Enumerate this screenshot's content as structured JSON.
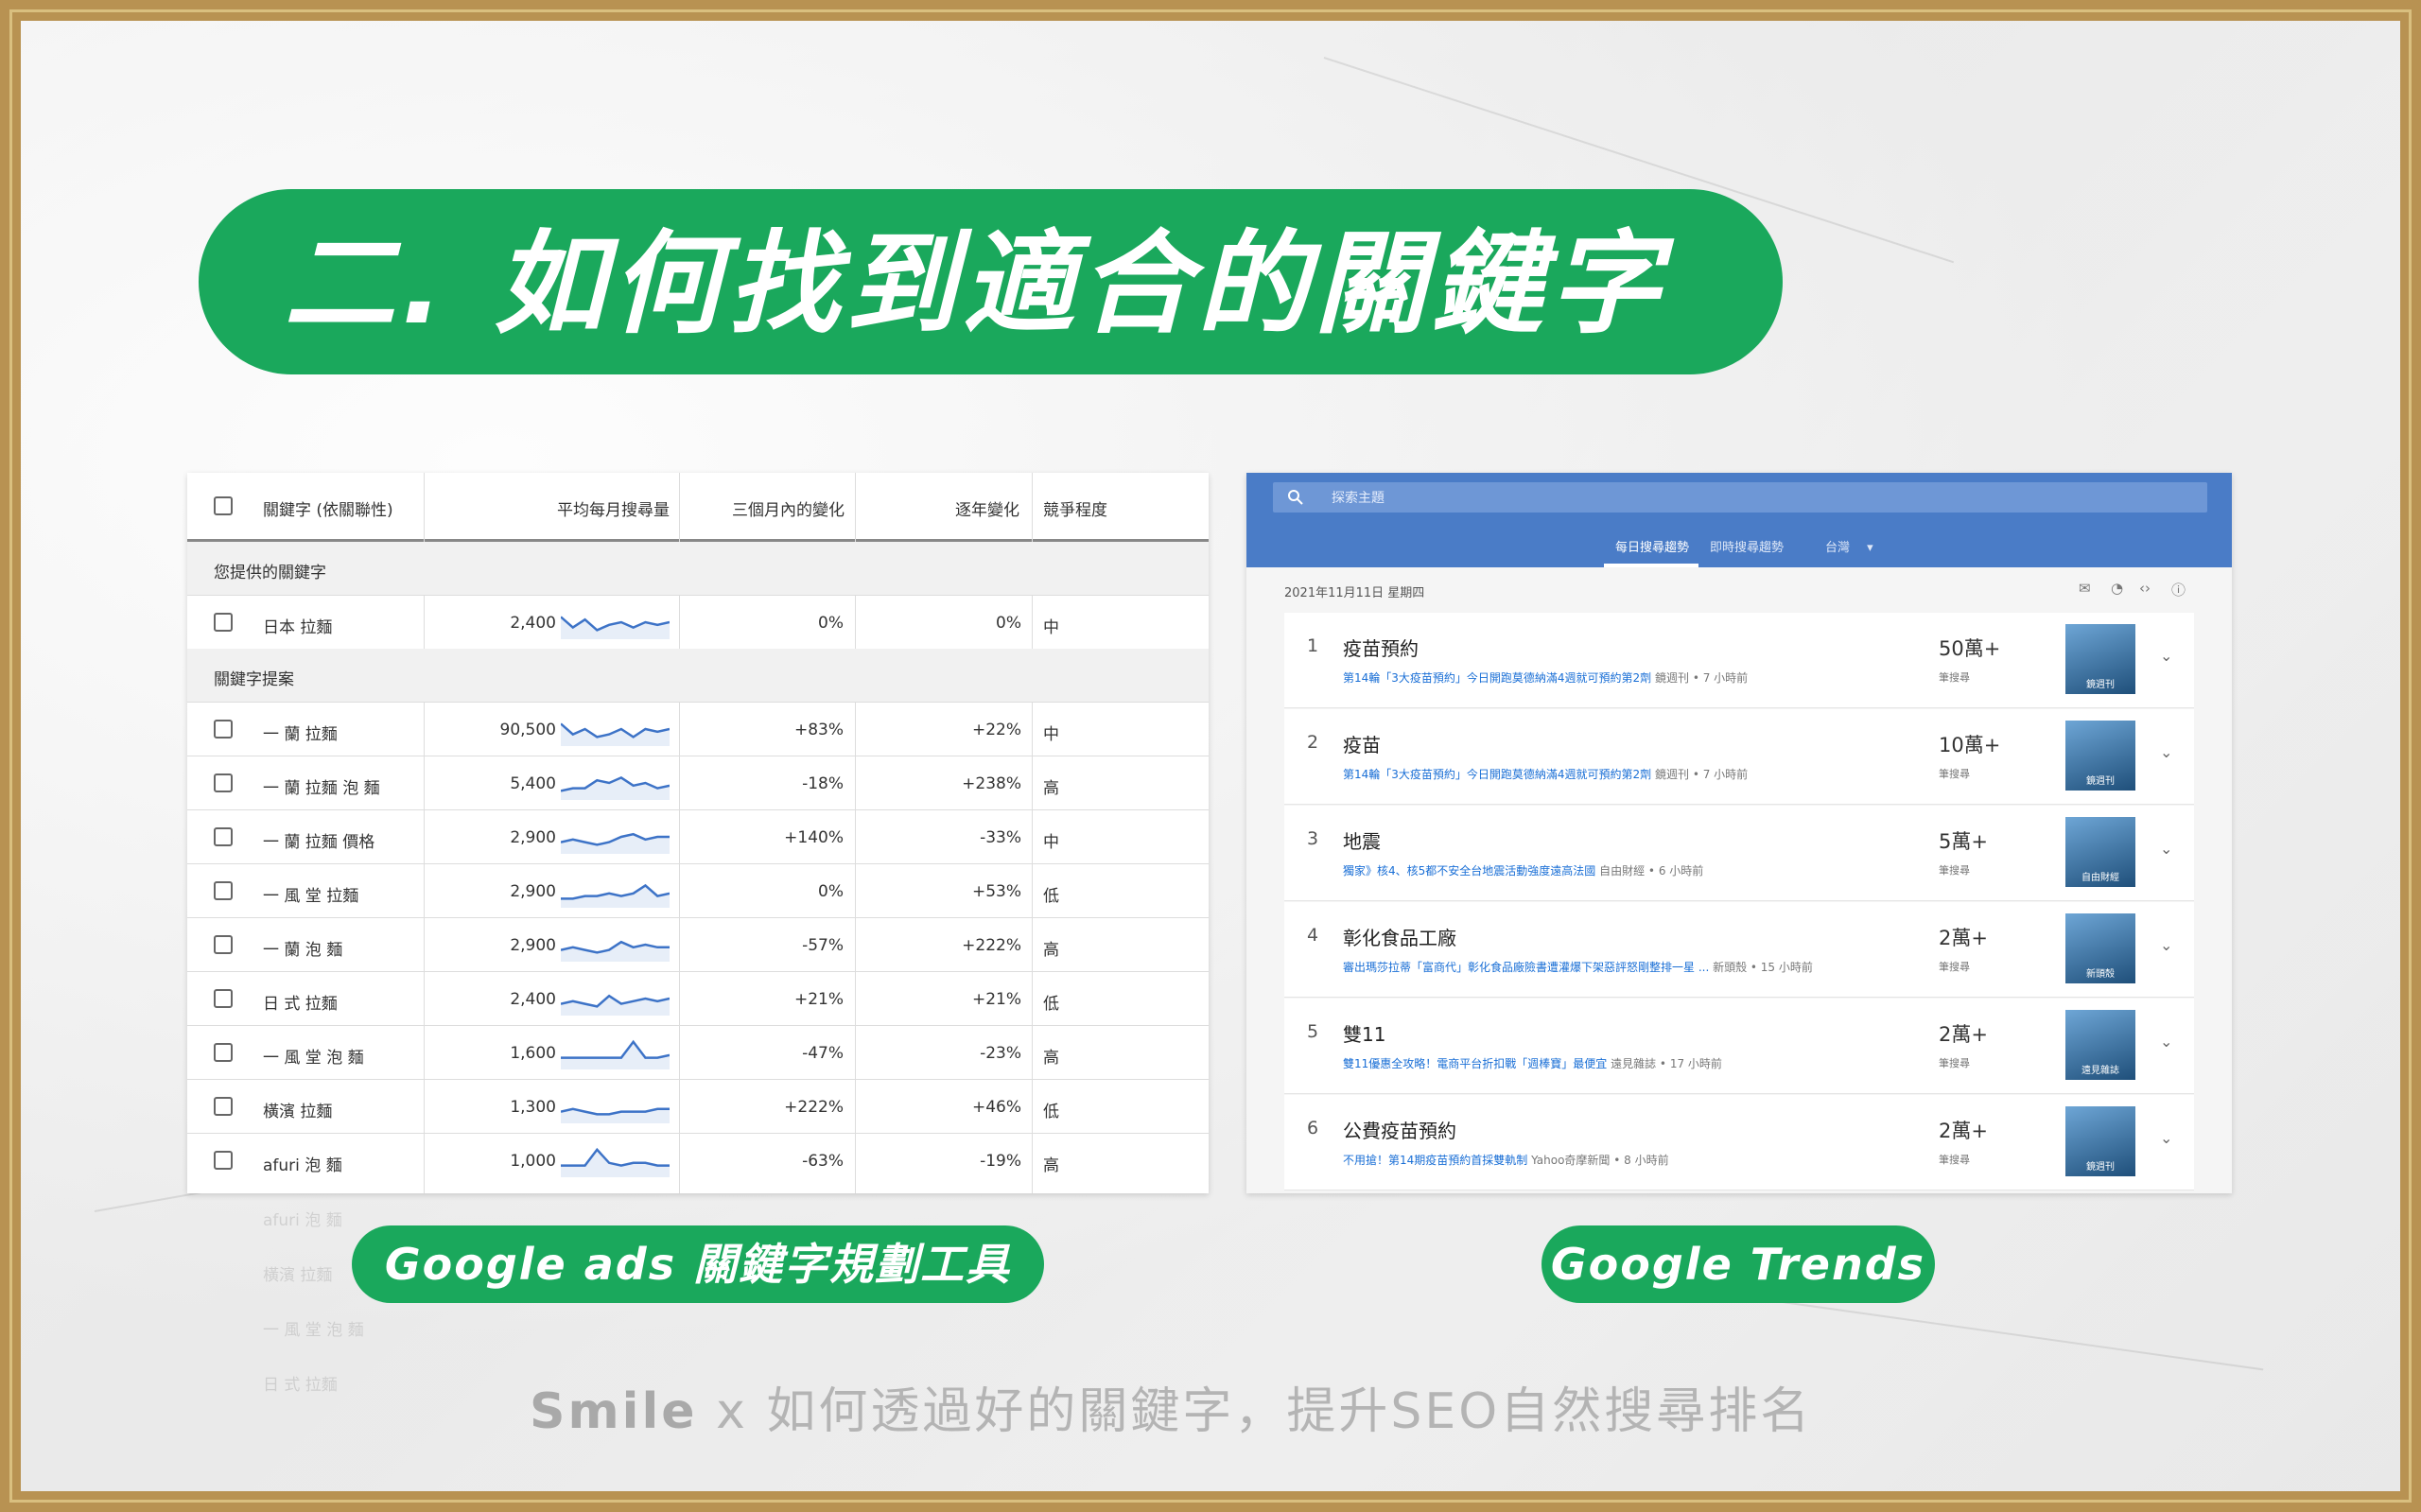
{
  "title": "二. 如何找到適合的關鍵字",
  "ads_table": {
    "headers": [
      "關鍵字 (依關聯性)",
      "平均每月搜尋量",
      "三個月內的變化",
      "逐年變化",
      "競爭程度"
    ],
    "section_provided": "您提供的關鍵字",
    "section_suggested": "關鍵字提案",
    "provided_rows": [
      {
        "keyword": "日本 拉麵",
        "volume": "2,400",
        "change_3m": "0%",
        "change_yoy": "0%",
        "competition": "中"
      }
    ],
    "suggested_rows": [
      {
        "keyword": "一 蘭 拉麵",
        "volume": "90,500",
        "change_3m": "+83%",
        "change_yoy": "+22%",
        "competition": "中"
      },
      {
        "keyword": "一 蘭 拉麵 泡 麵",
        "volume": "5,400",
        "change_3m": "-18%",
        "change_yoy": "+238%",
        "competition": "高"
      },
      {
        "keyword": "一 蘭 拉麵 價格",
        "volume": "2,900",
        "change_3m": "+140%",
        "change_yoy": "-33%",
        "competition": "中"
      },
      {
        "keyword": "一 風 堂 拉麵",
        "volume": "2,900",
        "change_3m": "0%",
        "change_yoy": "+53%",
        "competition": "低"
      },
      {
        "keyword": "一 蘭 泡 麵",
        "volume": "2,900",
        "change_3m": "-57%",
        "change_yoy": "+222%",
        "competition": "高"
      },
      {
        "keyword": "日 式 拉麵",
        "volume": "2,400",
        "change_3m": "+21%",
        "change_yoy": "+21%",
        "competition": "低"
      },
      {
        "keyword": "一 風 堂 泡 麵",
        "volume": "1,600",
        "change_3m": "-47%",
        "change_yoy": "-23%",
        "competition": "高"
      },
      {
        "keyword": "橫濱 拉麵",
        "volume": "1,300",
        "change_3m": "+222%",
        "change_yoy": "+46%",
        "competition": "低"
      },
      {
        "keyword": "afuri 泡 麵",
        "volume": "1,000",
        "change_3m": "-63%",
        "change_yoy": "-19%",
        "competition": "高"
      }
    ],
    "sparklines": [
      [
        0.7,
        0.3,
        0.6,
        0.2,
        0.4,
        0.5,
        0.3,
        0.5,
        0.4,
        0.5
      ],
      [
        0.7,
        0.3,
        0.5,
        0.2,
        0.3,
        0.5,
        0.2,
        0.5,
        0.4,
        0.5
      ],
      [
        0.2,
        0.3,
        0.3,
        0.6,
        0.5,
        0.7,
        0.4,
        0.5,
        0.3,
        0.4
      ],
      [
        0.3,
        0.4,
        0.3,
        0.2,
        0.3,
        0.5,
        0.6,
        0.4,
        0.5,
        0.5
      ],
      [
        0.2,
        0.2,
        0.3,
        0.3,
        0.4,
        0.3,
        0.4,
        0.7,
        0.3,
        0.4
      ],
      [
        0.3,
        0.4,
        0.3,
        0.2,
        0.3,
        0.6,
        0.4,
        0.5,
        0.4,
        0.4
      ],
      [
        0.3,
        0.4,
        0.3,
        0.2,
        0.6,
        0.3,
        0.4,
        0.5,
        0.4,
        0.5
      ],
      [
        0.3,
        0.3,
        0.3,
        0.3,
        0.3,
        0.3,
        0.9,
        0.3,
        0.3,
        0.4
      ],
      [
        0.3,
        0.4,
        0.3,
        0.2,
        0.2,
        0.3,
        0.3,
        0.3,
        0.4,
        0.4
      ],
      [
        0.3,
        0.3,
        0.3,
        0.9,
        0.4,
        0.3,
        0.4,
        0.4,
        0.3,
        0.3
      ]
    ],
    "reflection_rows": [
      "afuri 泡 麵",
      "橫濱 拉麵",
      "一 風 堂 泡 麵",
      "日 式 拉麵"
    ]
  },
  "trends": {
    "search_placeholder": "探索主題",
    "tabs": [
      "每日搜尋趨勢",
      "即時搜尋趨勢",
      "台灣"
    ],
    "date": "2021年11月11日 星期四",
    "searches_label": "筆搜尋",
    "items": [
      {
        "rank": "1",
        "title": "疫苗預約",
        "snippet": "第14輪「3大疫苗預約」今日開跑莫德納滿4週就可預約第2劑",
        "source": "鏡週刊 • 7 小時前",
        "count": "50萬+",
        "thumb_caption": "鏡週刊"
      },
      {
        "rank": "2",
        "title": "疫苗",
        "snippet": "第14輪「3大疫苗預約」今日開跑莫德納滿4週就可預約第2劑",
        "source": "鏡週刊 • 7 小時前",
        "count": "10萬+",
        "thumb_caption": "鏡週刊"
      },
      {
        "rank": "3",
        "title": "地震",
        "snippet": "獨家》核4、核5都不安全台地震活動強度遠高法國",
        "source": "自由財經 • 6 小時前",
        "count": "5萬+",
        "thumb_caption": "自由財經"
      },
      {
        "rank": "4",
        "title": "彰化食品工廠",
        "snippet": "審出瑪莎拉蒂「富商代」彰化食品廠險書遭灌爆下架惡評怒剛整排一星 ...",
        "source": "新頭殼 • 15 小時前",
        "count": "2萬+",
        "thumb_caption": "新頭殼"
      },
      {
        "rank": "5",
        "title": "雙11",
        "snippet": "雙11優惠全攻略！電商平台折扣戰「週棒寶」最便宜",
        "source": "遠見雜誌 • 17 小時前",
        "count": "2萬+",
        "thumb_caption": "遠見雜誌"
      },
      {
        "rank": "6",
        "title": "公費疫苗預約",
        "snippet": "不用搶！第14期疫苗預約首採雙軌制",
        "source": "Yahoo奇摩新聞 • 8 小時前",
        "count": "2萬+",
        "thumb_caption": "鏡週刊"
      }
    ]
  },
  "labels": {
    "ads": "Google ads 關鍵字規劃工具",
    "trends": "Google Trends"
  },
  "footer": {
    "logo_s": "S",
    "logo_rest": "mile",
    "text": "x 如何透過好的關鍵字，提升SEO自然搜尋排名"
  },
  "colors": {
    "accent_green": "#1aa85c",
    "frame_gold": "#b89252",
    "trends_blue": "#4a7cc7",
    "sparkline": "#3d73c7"
  }
}
